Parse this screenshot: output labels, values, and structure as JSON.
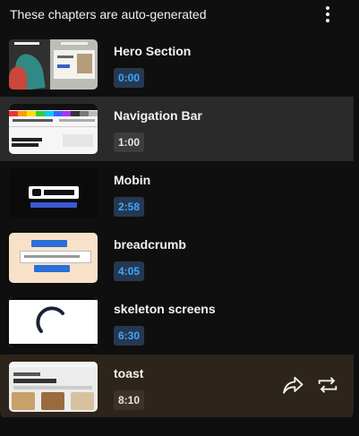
{
  "header": {
    "title": "These chapters are auto-generated",
    "menu_icon": "more-vert-icon"
  },
  "chapters": [
    {
      "title": "Hero Section",
      "time": "0:00",
      "state": "default"
    },
    {
      "title": "Navigation Bar",
      "time": "1:00",
      "state": "active"
    },
    {
      "title": "Mobin",
      "time": "2:58",
      "state": "default"
    },
    {
      "title": "breadcrumb",
      "time": "4:05",
      "state": "default"
    },
    {
      "title": "skeleton screens",
      "time": "6:30",
      "state": "default"
    },
    {
      "title": "toast",
      "time": "8:10",
      "state": "current"
    }
  ],
  "actions": {
    "share_icon": "share-icon",
    "loop_icon": "loop-icon"
  },
  "colors": {
    "background": "#0f0f0f",
    "active_row": "#2a2a2a",
    "current_row": "#2d241b",
    "accent_text": "#3ea6ff"
  }
}
